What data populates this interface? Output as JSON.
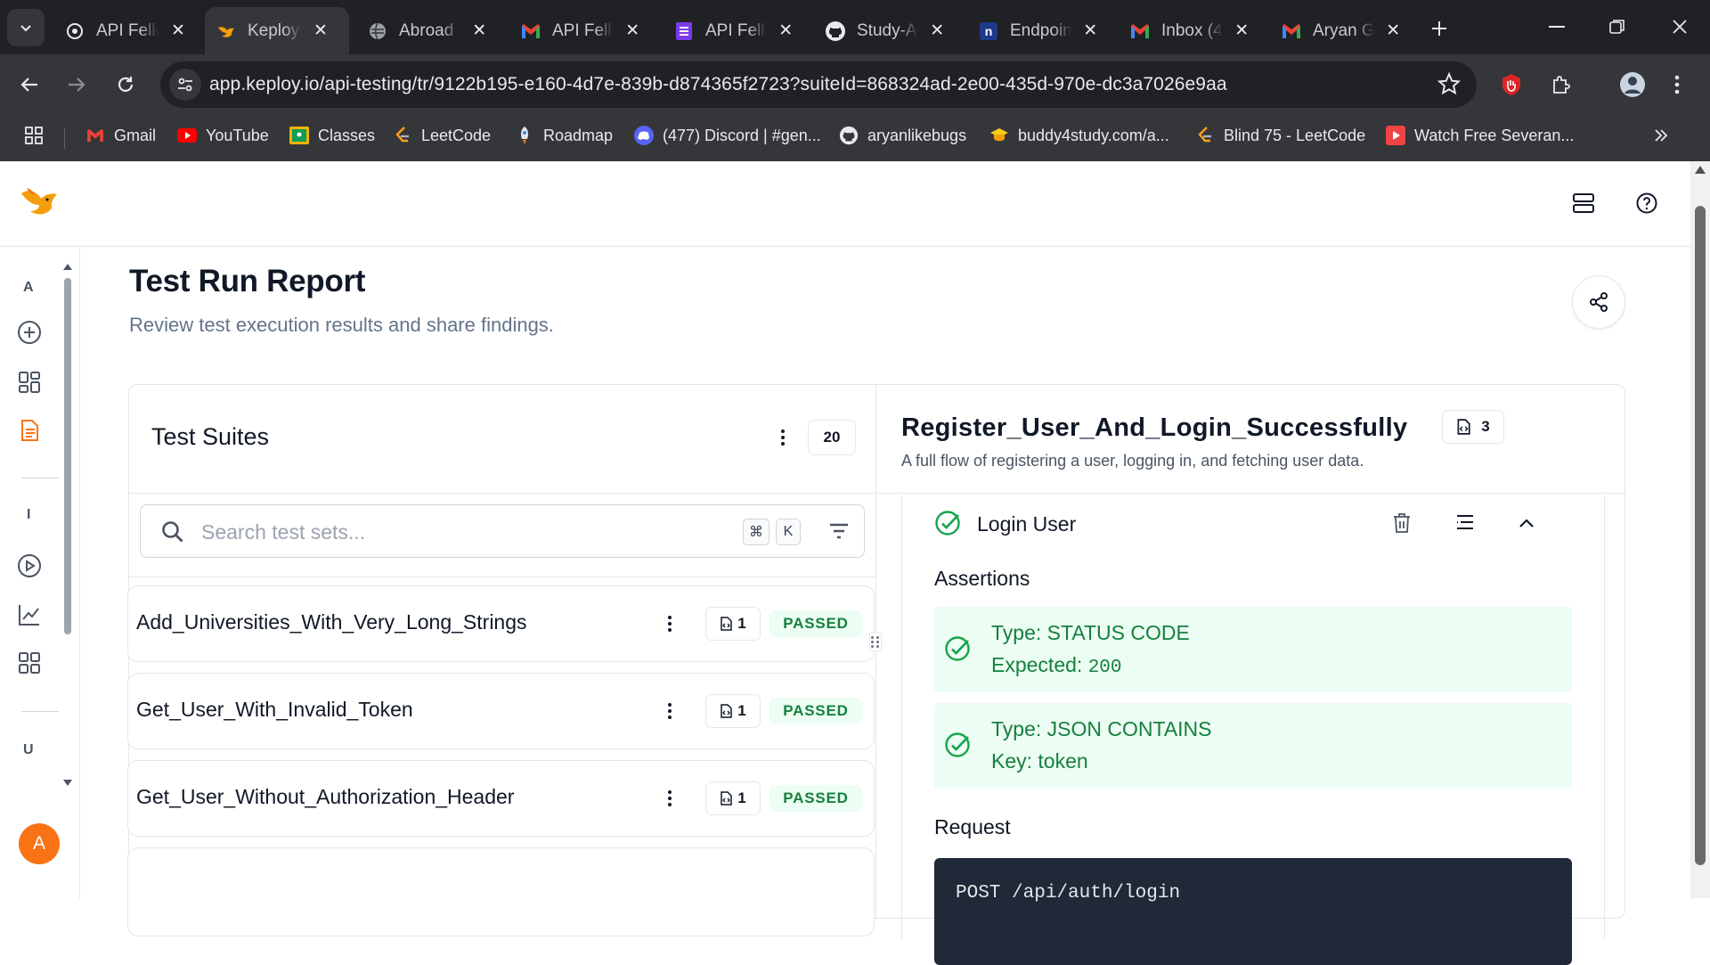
{
  "browser": {
    "tabs": [
      {
        "title": "API Fello",
        "favicon": "openai-icon",
        "active": false
      },
      {
        "title": "Keploy: Ap",
        "favicon": "keploy-icon",
        "active": true
      },
      {
        "title": "Abroad",
        "favicon": "globe-icon",
        "active": false
      },
      {
        "title": "API Fello",
        "favicon": "gmail-icon",
        "active": false
      },
      {
        "title": "API Fello",
        "favicon": "forms-icon",
        "active": false
      },
      {
        "title": "Study-Ab",
        "favicon": "github-icon",
        "active": false
      },
      {
        "title": "Endpoin",
        "favicon": "notion-icon",
        "active": false
      },
      {
        "title": "Inbox (4",
        "favicon": "gmail-icon",
        "active": false
      },
      {
        "title": "Aryan G",
        "favicon": "gmail-icon",
        "active": false
      }
    ],
    "url_host": "app.keploy.io",
    "url_rest": "/api-testing/tr/9122b195-e160-4d7e-839b-d874365f2723?suiteId=868324ad-2e00-435d-970e-dc3a7026e9aa",
    "bookmarks": [
      {
        "label": "Gmail",
        "icon": "gmail-icon"
      },
      {
        "label": "YouTube",
        "icon": "youtube-icon"
      },
      {
        "label": "Classes",
        "icon": "classroom-icon"
      },
      {
        "label": "LeetCode",
        "icon": "leetcode-icon"
      },
      {
        "label": "Roadmap",
        "icon": "rocket-icon"
      },
      {
        "label": "(477) Discord | #gen...",
        "icon": "discord-icon"
      },
      {
        "label": "aryanlikebugs",
        "icon": "github-icon"
      },
      {
        "label": "buddy4study.com/a...",
        "icon": "buddy4study-icon"
      },
      {
        "label": "Blind 75 - LeetCode",
        "icon": "leetcode-icon"
      },
      {
        "label": "Watch Free Severan...",
        "icon": "video-icon"
      }
    ]
  },
  "sidebar": {
    "sections": [
      "A",
      "I",
      "U"
    ],
    "avatar_initial": "A"
  },
  "page": {
    "title": "Test Run Report",
    "subtitle": "Review test execution results and share findings."
  },
  "test_suites": {
    "title": "Test Suites",
    "count": "20",
    "search_placeholder": "Search test sets...",
    "shortcut_cmd": "⌘",
    "shortcut_key": "K",
    "items": [
      {
        "name": "Add_Universities_With_Very_Long_Strings",
        "steps": "1",
        "status": "PASSED"
      },
      {
        "name": "Get_User_With_Invalid_Token",
        "steps": "1",
        "status": "PASSED"
      },
      {
        "name": "Get_User_Without_Authorization_Header",
        "steps": "1",
        "status": "PASSED"
      }
    ]
  },
  "detail": {
    "title": "Register_User_And_Login_Successfully",
    "steps": "3",
    "description": "A full flow of registering a user, logging in, and fetching user data.",
    "step": {
      "name": "Login User",
      "assertions_title": "Assertions",
      "assertions": [
        {
          "line1": "Type: STATUS CODE",
          "line2_label": "Expected: ",
          "line2_value": "200"
        },
        {
          "line1": "Type: JSON CONTAINS",
          "line2_label": "Key: token",
          "line2_value": ""
        }
      ],
      "request_title": "Request",
      "request_code": "POST /api/auth/login"
    }
  },
  "colors": {
    "accent": "#f97316",
    "passed_text": "#15803d",
    "passed_bg": "#ecfdf3"
  }
}
